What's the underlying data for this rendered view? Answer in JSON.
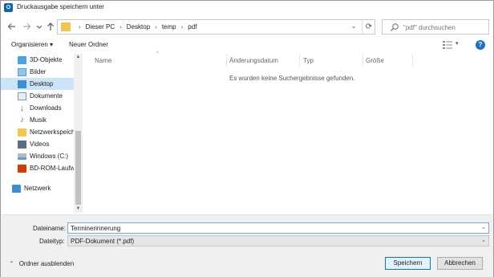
{
  "window": {
    "title": "Druckausgabe speichern unter",
    "app_icon_letter": "O"
  },
  "nav": {
    "back_icon": "arrow-left",
    "forward_icon": "arrow-right",
    "recent_icon": "chevron-down",
    "up_icon": "arrow-up",
    "breadcrumb": [
      "Dieser PC",
      "Desktop",
      "temp",
      "pdf"
    ],
    "search_placeholder": "\"pdf\" durchsuchen"
  },
  "toolbar": {
    "organize_label": "Organisieren ▾",
    "new_folder_label": "Neuer Ordner"
  },
  "sidebar": {
    "items": [
      {
        "label": "3D-Objekte",
        "icon": "3d-objects-icon",
        "color": "#4aa3df"
      },
      {
        "label": "Bilder",
        "icon": "pictures-icon",
        "color": "#4aa3df"
      },
      {
        "label": "Desktop",
        "icon": "desktop-icon",
        "color": "#3b8ed6",
        "selected": true
      },
      {
        "label": "Dokumente",
        "icon": "documents-icon",
        "color": "#7a9bb8"
      },
      {
        "label": "Downloads",
        "icon": "downloads-icon",
        "color": "#2f7fd1"
      },
      {
        "label": "Musik",
        "icon": "music-icon",
        "color": "#2f7fd1"
      },
      {
        "label": "Netzwerkspeiche",
        "icon": "network-folder-icon",
        "color": "#f3c64b"
      },
      {
        "label": "Videos",
        "icon": "videos-icon",
        "color": "#5a6f86"
      },
      {
        "label": "Windows (C:)",
        "icon": "drive-icon",
        "color": "#8a8a8a"
      },
      {
        "label": "BD-ROM-Laufwe",
        "icon": "office-drive-icon",
        "color": "#d83b01"
      },
      {
        "label": "Netzwerk",
        "icon": "network-icon",
        "color": "#3b8ed6"
      }
    ]
  },
  "content": {
    "columns": [
      "Name",
      "Änderungsdatum",
      "Typ",
      "Größe"
    ],
    "empty_message": "Es wurden keine Suchergebnisse gefunden."
  },
  "form": {
    "filename_label": "Dateiname:",
    "filename_value": "Terminerinnerung",
    "filetype_label": "Dateityp:",
    "filetype_value": "PDF-Dokument (*.pdf)"
  },
  "footer": {
    "hide_folders_label": "Ordner ausblenden",
    "save_label": "Speichern",
    "cancel_label": "Abbrechen"
  },
  "colors": {
    "accent": "#0078d7",
    "selection": "#cce4f7",
    "panel": "#f0f0f0"
  }
}
